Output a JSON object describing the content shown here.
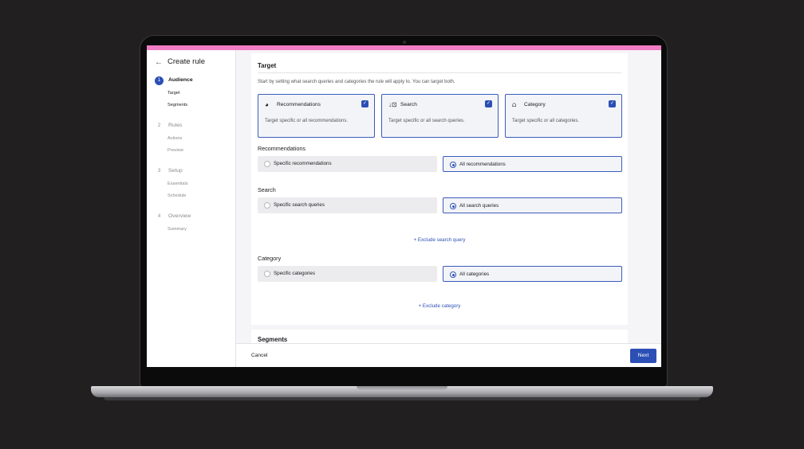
{
  "sidebar": {
    "title": "Create rule",
    "steps": [
      {
        "num": "1",
        "label": "Audience",
        "subs": [
          "Target",
          "Segments"
        ]
      },
      {
        "num": "2",
        "label": "Rules",
        "subs": [
          "Actions",
          "Preview"
        ]
      },
      {
        "num": "3",
        "label": "Setup",
        "subs": [
          "Essentials",
          "Schedule"
        ]
      },
      {
        "num": "4",
        "label": "Overview",
        "subs": [
          "Summary"
        ]
      }
    ]
  },
  "main": {
    "heading": "Target",
    "intro": "Start by setting what search queries and categories the rule will apply to. You can target both.",
    "targets": [
      {
        "icon": "recommendations-icon",
        "name": "Recommendations",
        "desc": "Target specific or all recommendations.",
        "checked": true
      },
      {
        "icon": "search-sort-icon",
        "name": "Search",
        "desc": "Target specific or all search queries.",
        "checked": true
      },
      {
        "icon": "category-shapes-icon",
        "name": "Category",
        "desc": "Target specific or all categories.",
        "checked": true
      }
    ],
    "recommendations": {
      "label": "Recommendations",
      "specific": "Specific recommendations",
      "all": "All recommendations"
    },
    "search": {
      "label": "Search",
      "specific": "Specific search queries",
      "all": "All search queries",
      "exclude": "+ Exclude search query"
    },
    "category": {
      "label": "Category",
      "specific": "Specific categories",
      "all": "All categories",
      "exclude": "+ Exclude category"
    },
    "segments_heading": "Segments"
  },
  "footer": {
    "cancel": "Cancel",
    "next": "Next"
  },
  "colors": {
    "accent": "#2c4fb5",
    "topbar": "#f07dc3"
  }
}
